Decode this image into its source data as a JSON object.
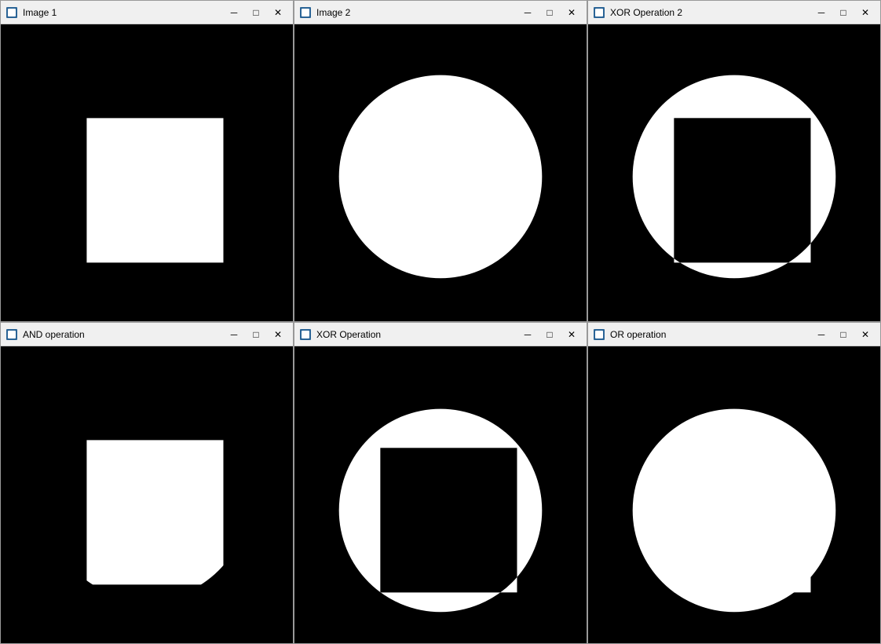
{
  "windows": [
    {
      "id": "image1",
      "title": "Image 1",
      "content": "white-square"
    },
    {
      "id": "image2",
      "title": "Image 2",
      "content": "white-circle"
    },
    {
      "id": "xor2",
      "title": "XOR Operation 2",
      "content": "xor2"
    },
    {
      "id": "and",
      "title": "AND operation",
      "content": "and"
    },
    {
      "id": "xor",
      "title": "XOR Operation",
      "content": "xor"
    },
    {
      "id": "or",
      "title": "OR operation",
      "content": "or"
    }
  ],
  "controls": {
    "minimize": "─",
    "maximize": "□",
    "close": "✕"
  }
}
